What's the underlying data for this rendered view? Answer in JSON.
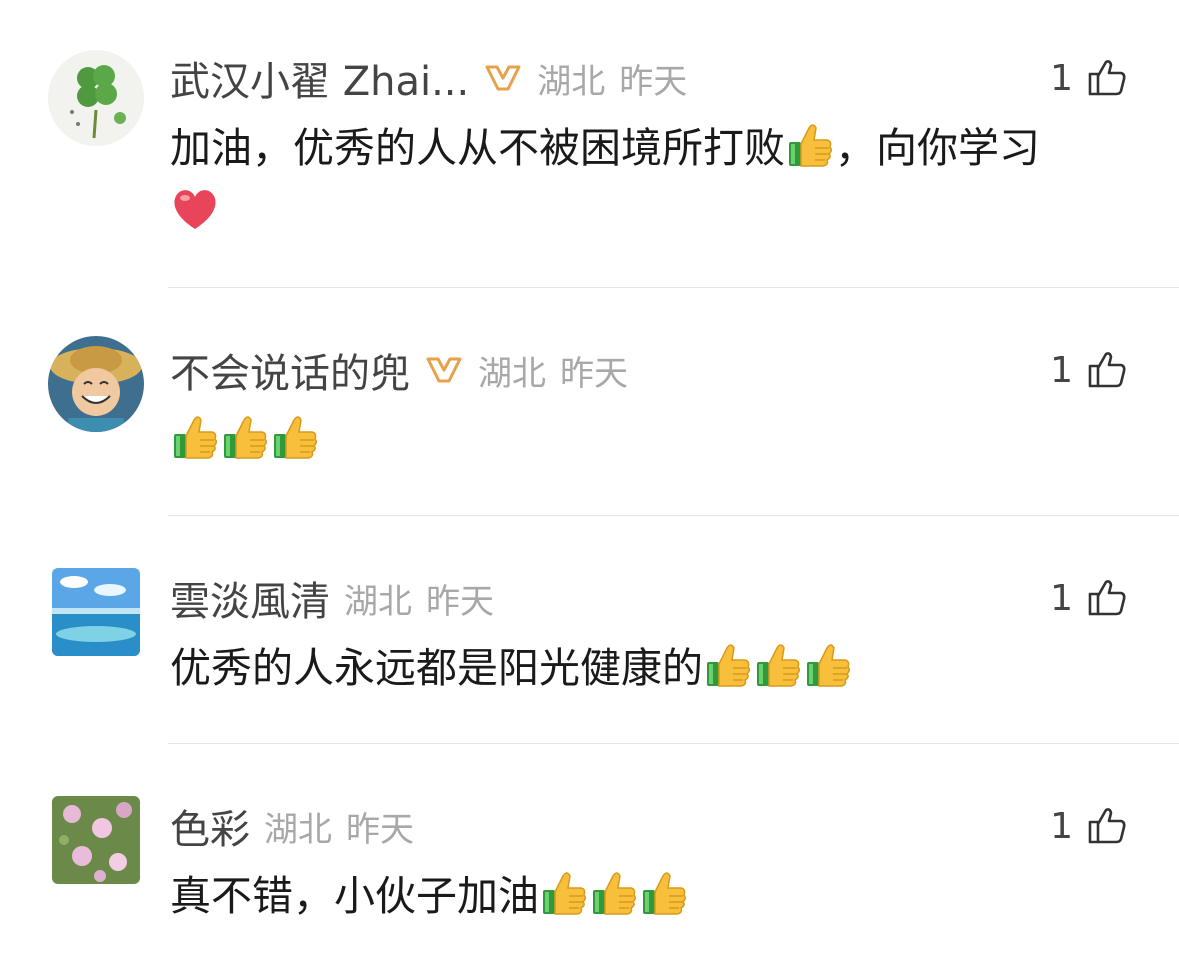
{
  "comments": [
    {
      "username": "武汉小翟 Zhai...",
      "location": "湖北",
      "time": "昨天",
      "likes": "1",
      "text": "加油，优秀的人从不被困境所打败",
      "text_after": "，向你学习",
      "emojis": [
        "thumbs-up-emoji",
        "heart-emoji"
      ]
    },
    {
      "username": "不会说话的兜",
      "location": "湖北",
      "time": "昨天",
      "likes": "1",
      "emojis": [
        "thumbs-up-emoji",
        "thumbs-up-emoji",
        "thumbs-up-emoji"
      ]
    },
    {
      "username": "雲淡風清",
      "location": "湖北",
      "time": "昨天",
      "likes": "1",
      "text": "优秀的人永远都是阳光健康的",
      "emojis": [
        "thumbs-up-emoji",
        "thumbs-up-emoji",
        "thumbs-up-emoji"
      ]
    },
    {
      "username": "色彩",
      "location": "湖北",
      "time": "昨天",
      "likes": "1",
      "text": "真不错，小伙子加油",
      "emojis": [
        "thumbs-up-emoji",
        "thumbs-up-emoji",
        "thumbs-up-emoji"
      ]
    }
  ],
  "colors": {
    "vip_badge": "#e8a04a",
    "meta": "#a8a8a8",
    "divider": "#e6e6e6"
  }
}
